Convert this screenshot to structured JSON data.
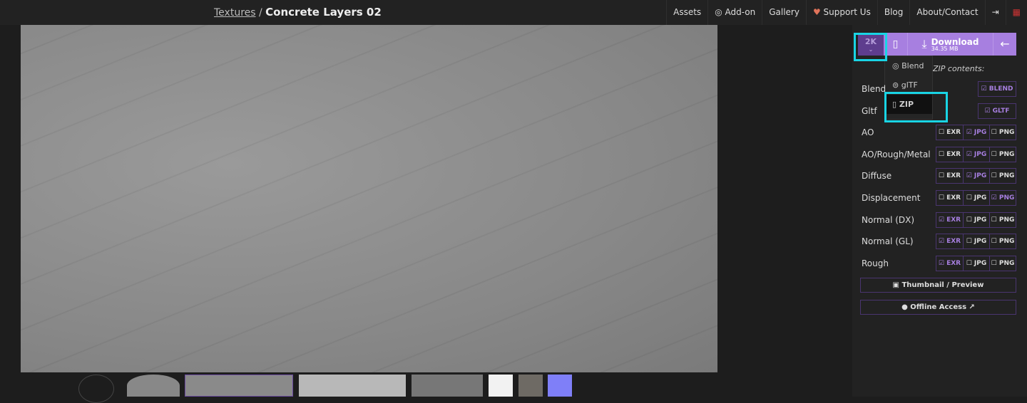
{
  "header": {
    "breadcrumb_parent": "Textures",
    "separator": "/",
    "title": "Concrete Layers 02",
    "nav": [
      "Assets",
      "Add-on",
      "Gallery",
      "Support Us",
      "Blog",
      "About/Contact"
    ]
  },
  "download": {
    "resolution": "2K",
    "label": "Download",
    "size": "34.35 MB"
  },
  "format_menu": [
    "Blend",
    "glTF",
    "ZIP"
  ],
  "zip_contents_label": "ZIP contents:",
  "rows": [
    {
      "label": "Blend",
      "options": [
        {
          "t": "BLEND",
          "on": true
        }
      ]
    },
    {
      "label": "Gltf",
      "options": [
        {
          "t": "GLTF",
          "on": true
        }
      ]
    },
    {
      "label": "AO",
      "options": [
        {
          "t": "EXR",
          "on": false
        },
        {
          "t": "JPG",
          "on": true
        },
        {
          "t": "PNG",
          "on": false
        }
      ]
    },
    {
      "label": "AO/Rough/Metal",
      "options": [
        {
          "t": "EXR",
          "on": false
        },
        {
          "t": "JPG",
          "on": true
        },
        {
          "t": "PNG",
          "on": false
        }
      ]
    },
    {
      "label": "Diffuse",
      "options": [
        {
          "t": "EXR",
          "on": false
        },
        {
          "t": "JPG",
          "on": true
        },
        {
          "t": "PNG",
          "on": false
        }
      ]
    },
    {
      "label": "Displacement",
      "options": [
        {
          "t": "EXR",
          "on": false
        },
        {
          "t": "JPG",
          "on": false
        },
        {
          "t": "PNG",
          "on": true
        }
      ]
    },
    {
      "label": "Normal (DX)",
      "options": [
        {
          "t": "EXR",
          "on": true
        },
        {
          "t": "JPG",
          "on": false
        },
        {
          "t": "PNG",
          "on": false
        }
      ]
    },
    {
      "label": "Normal (GL)",
      "options": [
        {
          "t": "EXR",
          "on": true
        },
        {
          "t": "JPG",
          "on": false
        },
        {
          "t": "PNG",
          "on": false
        }
      ]
    },
    {
      "label": "Rough",
      "options": [
        {
          "t": "EXR",
          "on": true
        },
        {
          "t": "JPG",
          "on": false
        },
        {
          "t": "PNG",
          "on": false
        }
      ]
    }
  ],
  "thumbnail_button": "Thumbnail / Preview",
  "offline_button": "Offline Access",
  "colors": {
    "accent": "#a77fe0",
    "highlight": "#19d4e4"
  }
}
